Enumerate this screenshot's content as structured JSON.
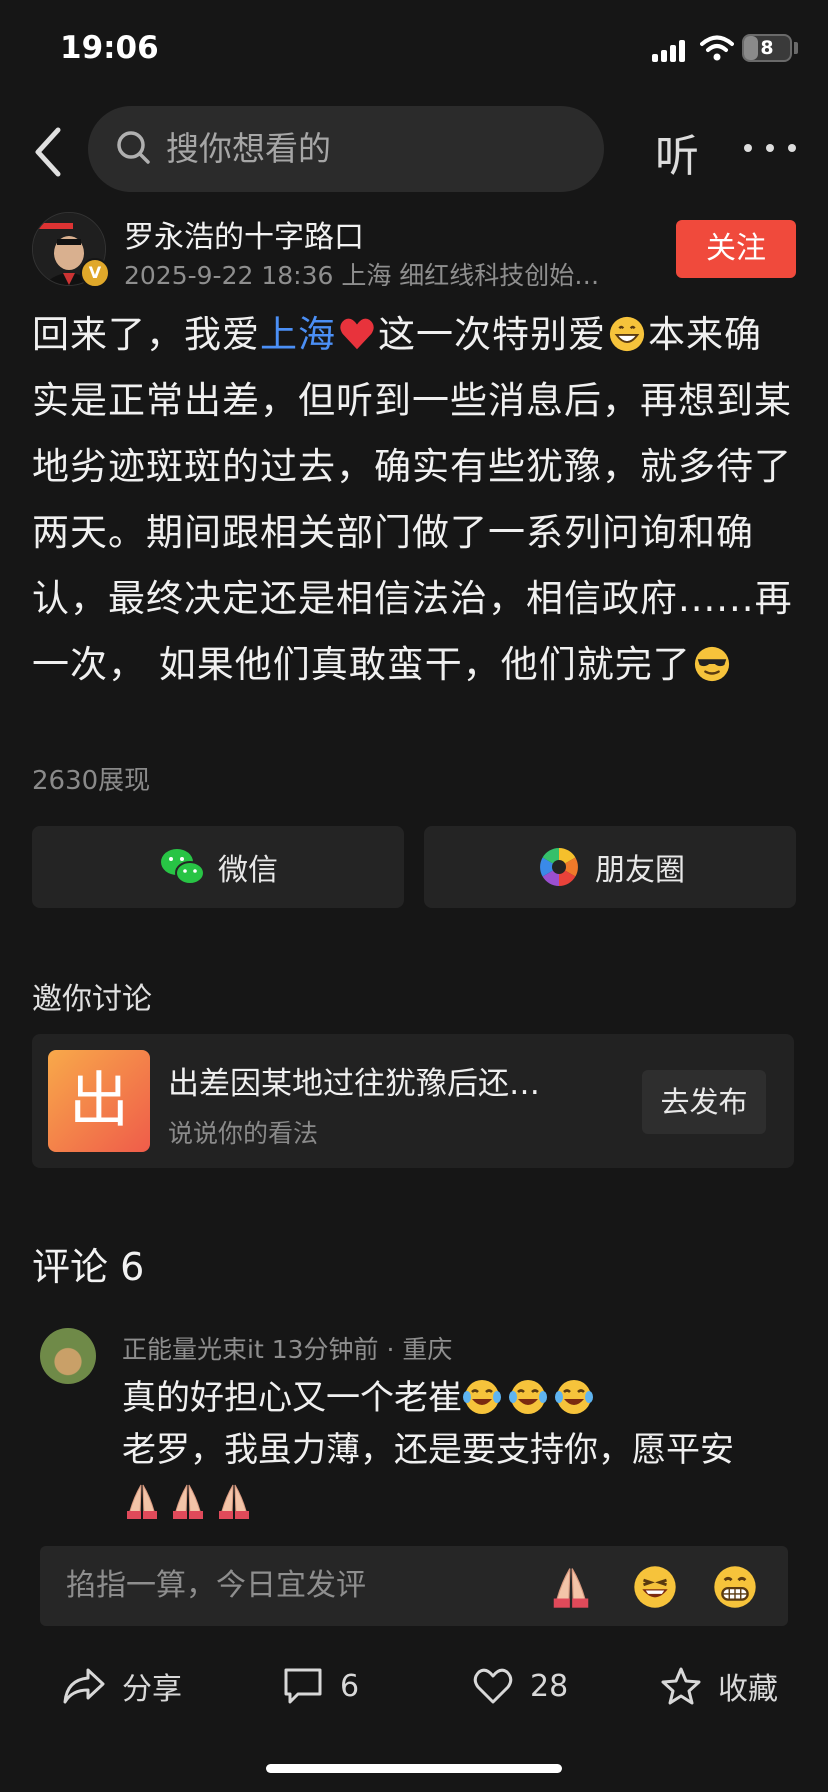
{
  "status_bar": {
    "time": "19:06",
    "battery_level": "8"
  },
  "nav": {
    "search_placeholder": "搜你想看的",
    "listen_label": "听"
  },
  "author": {
    "name": "罗永浩的十字路口",
    "meta": "2025-9-22 18:36  上海  细红线科技创始…",
    "verified_badge": "V",
    "follow_label": "关注"
  },
  "post": {
    "p1": "回来了，我爱",
    "link": "上海",
    "p2": "这一次特别爱",
    "p3": "本来确实是正常出差，但听到一些消息后，再想到某地劣迹斑斑的过去，确实有些犹豫，就多待了两天。期间跟相关部门做了一系列问询和确认，最终决定还是相信法治，相信政府......再一次， 如果他们真敢蛮干，他们就完了",
    "views": "2630展现"
  },
  "share": {
    "wechat_label": "微信",
    "moments_label": "朋友圈"
  },
  "discuss": {
    "section_title": "邀你讨论",
    "tile_char": "出",
    "title": "出差因某地过往犹豫后还…",
    "subtitle": "说说你的看法",
    "button_label": "去发布"
  },
  "comments": {
    "title": "评论 6",
    "items": [
      {
        "user": "正能量光束it",
        "meta": "正能量光束it  13分钟前 · 重庆",
        "line1": "真的好担心又一个老崔",
        "line2": "老罗，我虽力薄，还是要支持你，愿平安"
      }
    ]
  },
  "input": {
    "placeholder": "掐指一算，今日宜发评"
  },
  "actions": {
    "share_label": "分享",
    "comment_count": "6",
    "like_count": "28",
    "collect_label": "收藏"
  },
  "colors": {
    "accent": "#f04a3c",
    "link": "#4b8ff5",
    "background": "#161616"
  }
}
